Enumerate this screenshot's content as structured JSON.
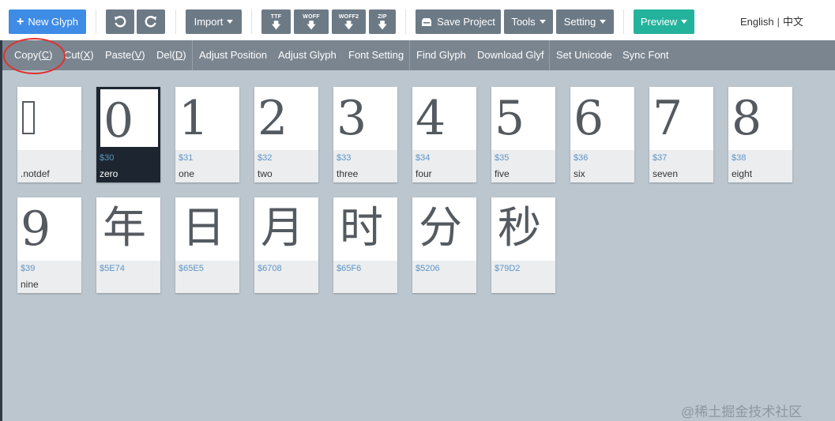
{
  "toolbar": {
    "new_glyph": "New Glyph",
    "undo_icon": "undo-icon",
    "redo_icon": "redo-icon",
    "import": "Import",
    "ttf": "TTF",
    "woff": "WOFF",
    "woff2": "WOFF2",
    "zip": "ZIP",
    "save_project": "Save Project",
    "tools": "Tools",
    "setting": "Setting",
    "preview": "Preview",
    "lang_en": "English",
    "lang_divider": "|",
    "lang_zh": "中文",
    "accent_blue": "#3f8ce6",
    "accent_teal": "#23b39c",
    "gray": "#6c7a86"
  },
  "menubar": {
    "copy": "Copy(",
    "copy_key": "C",
    "cut": "Cut(",
    "cut_key": "X",
    "paste": "Paste(",
    "paste_key": "V",
    "del": "Del(",
    "del_key": "D",
    "close_paren": ")",
    "adjust_position": "Adjust Position",
    "adjust_glyph": "Adjust Glyph",
    "font_setting": "Font Setting",
    "find_glyph": "Find Glyph",
    "download_glyf": "Download Glyf",
    "set_unicode": "Set Unicode",
    "sync_font": "Sync Font"
  },
  "glyphs": [
    {
      "char": "",
      "code": "",
      "name": ".notdef",
      "notdef": true
    },
    {
      "char": "0",
      "code": "$30",
      "name": "zero",
      "selected": true
    },
    {
      "char": "1",
      "code": "$31",
      "name": "one"
    },
    {
      "char": "2",
      "code": "$32",
      "name": "two"
    },
    {
      "char": "3",
      "code": "$33",
      "name": "three"
    },
    {
      "char": "4",
      "code": "$34",
      "name": "four"
    },
    {
      "char": "5",
      "code": "$35",
      "name": "five"
    },
    {
      "char": "6",
      "code": "$36",
      "name": "six"
    },
    {
      "char": "7",
      "code": "$37",
      "name": "seven"
    },
    {
      "char": "8",
      "code": "$38",
      "name": "eight"
    },
    {
      "char": "9",
      "code": "$39",
      "name": "nine"
    },
    {
      "char": "年",
      "code": "$5E74",
      "name": "",
      "cjk": true
    },
    {
      "char": "日",
      "code": "$65E5",
      "name": "",
      "cjk": true
    },
    {
      "char": "月",
      "code": "$6708",
      "name": "",
      "cjk": true
    },
    {
      "char": "时",
      "code": "$65F6",
      "name": "",
      "cjk": true
    },
    {
      "char": "分",
      "code": "$5206",
      "name": "",
      "cjk": true
    },
    {
      "char": "秒",
      "code": "$79D2",
      "name": "",
      "cjk": true
    }
  ],
  "watermark": "@稀土掘金技术社区"
}
